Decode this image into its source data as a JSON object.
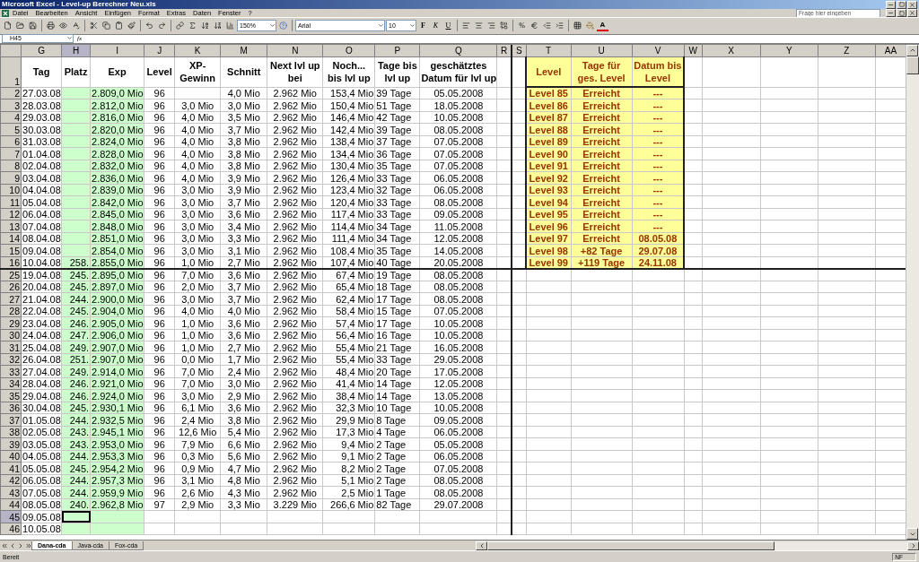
{
  "window": {
    "title": "Microsoft Excel - Level-up Berechner Neu.xls"
  },
  "menu": [
    {
      "label": "Datei"
    },
    {
      "label": "Bearbeiten"
    },
    {
      "label": "Ansicht"
    },
    {
      "label": "Einfügen"
    },
    {
      "label": "Format"
    },
    {
      "label": "Extras"
    },
    {
      "label": "Daten"
    },
    {
      "label": "Fenster"
    },
    {
      "label": "?"
    }
  ],
  "help_search": {
    "placeholder": "Frage hier eingeben"
  },
  "toolbar": {
    "zoom": "150%",
    "font": "Arial",
    "font_size": "10",
    "bold": "F",
    "italic": "K",
    "underline": "U",
    "percent": "%",
    "font_color": "A"
  },
  "formula_bar": {
    "name_box": "H45",
    "fx": "fx"
  },
  "columns": {
    "left": [
      {
        "label": "G",
        "selected": false,
        "shaded": false
      },
      {
        "label": "H",
        "selected": true,
        "shaded": true
      },
      {
        "label": "I",
        "selected": false,
        "shaded": true
      },
      {
        "label": "J",
        "selected": false,
        "shaded": false
      },
      {
        "label": "K",
        "selected": false,
        "shaded": false
      },
      {
        "label": "M",
        "selected": false,
        "shaded": false
      },
      {
        "label": "N",
        "selected": false,
        "shaded": false
      },
      {
        "label": "O",
        "selected": false,
        "shaded": false
      },
      {
        "label": "P",
        "selected": false,
        "shaded": false
      },
      {
        "label": "Q",
        "selected": false,
        "shaded": false
      },
      {
        "label": "R",
        "selected": false,
        "shaded": false
      }
    ],
    "right": [
      {
        "label": "S",
        "selected": false
      },
      {
        "label": "T",
        "selected": false
      },
      {
        "label": "U",
        "selected": false
      },
      {
        "label": "V",
        "selected": false
      },
      {
        "label": "W",
        "selected": false
      },
      {
        "label": "X",
        "selected": false
      },
      {
        "label": "Y",
        "selected": false
      },
      {
        "label": "Z",
        "selected": false
      },
      {
        "label": "AA",
        "selected": false
      }
    ]
  },
  "header_row": {
    "number": "1",
    "selected": false,
    "cells": [
      "Tag",
      "Platz",
      "Exp",
      "Level",
      "XP-\nGewinn",
      "Schnitt",
      "Next lvl up\nbei",
      "Noch...\nbis lvl up",
      "Tage bis\nlvl up",
      "geschätztes\nDatum für lvl up"
    ],
    "level_table": [
      "Level",
      "Tage für\nges. Level",
      "Datum bis\nLevel"
    ]
  },
  "top_rows": [
    {
      "number": "2",
      "selected": false,
      "cells": [
        "27.03.08",
        "",
        "2.809,0 Mio",
        "96",
        "",
        "4,0 Mio",
        "2.962 Mio",
        "153,4 Mio",
        "39 Tage",
        "05.05.2008"
      ],
      "level_table": [
        "Level 85",
        "Erreicht",
        "---"
      ]
    },
    {
      "number": "3",
      "selected": false,
      "cells": [
        "28.03.08",
        "",
        "2.812,0 Mio",
        "96",
        "3,0 Mio",
        "3,0 Mio",
        "2.962 Mio",
        "150,4 Mio",
        "51 Tage",
        "18.05.2008"
      ],
      "level_table": [
        "Level 86",
        "Erreicht",
        "---"
      ]
    },
    {
      "number": "4",
      "selected": false,
      "cells": [
        "29.03.08",
        "",
        "2.816,0 Mio",
        "96",
        "4,0 Mio",
        "3,5 Mio",
        "2.962 Mio",
        "146,4 Mio",
        "42 Tage",
        "10.05.2008"
      ],
      "level_table": [
        "Level 87",
        "Erreicht",
        "---"
      ]
    },
    {
      "number": "5",
      "selected": false,
      "cells": [
        "30.03.08",
        "",
        "2.820,0 Mio",
        "96",
        "4,0 Mio",
        "3,7 Mio",
        "2.962 Mio",
        "142,4 Mio",
        "39 Tage",
        "08.05.2008"
      ],
      "level_table": [
        "Level 88",
        "Erreicht",
        "---"
      ]
    },
    {
      "number": "6",
      "selected": false,
      "cells": [
        "31.03.08",
        "",
        "2.824,0 Mio",
        "96",
        "4,0 Mio",
        "3,8 Mio",
        "2.962 Mio",
        "138,4 Mio",
        "37 Tage",
        "07.05.2008"
      ],
      "level_table": [
        "Level 89",
        "Erreicht",
        "---"
      ]
    },
    {
      "number": "7",
      "selected": false,
      "cells": [
        "01.04.08",
        "",
        "2.828,0 Mio",
        "96",
        "4,0 Mio",
        "3,8 Mio",
        "2.962 Mio",
        "134,4 Mio",
        "36 Tage",
        "07.05.2008"
      ],
      "level_table": [
        "Level 90",
        "Erreicht",
        "---"
      ]
    },
    {
      "number": "8",
      "selected": false,
      "cells": [
        "02.04.08",
        "",
        "2.832,0 Mio",
        "96",
        "4,0 Mio",
        "3,8 Mio",
        "2.962 Mio",
        "130,4 Mio",
        "35 Tage",
        "07.05.2008"
      ],
      "level_table": [
        "Level 91",
        "Erreicht",
        "---"
      ]
    },
    {
      "number": "9",
      "selected": false,
      "cells": [
        "03.04.08",
        "",
        "2.836,0 Mio",
        "96",
        "4,0 Mio",
        "3,9 Mio",
        "2.962 Mio",
        "126,4 Mio",
        "33 Tage",
        "06.05.2008"
      ],
      "level_table": [
        "Level 92",
        "Erreicht",
        "---"
      ]
    },
    {
      "number": "10",
      "selected": false,
      "cells": [
        "04.04.08",
        "",
        "2.839,0 Mio",
        "96",
        "3,0 Mio",
        "3,9 Mio",
        "2.962 Mio",
        "123,4 Mio",
        "32 Tage",
        "06.05.2008"
      ],
      "level_table": [
        "Level 93",
        "Erreicht",
        "---"
      ]
    },
    {
      "number": "11",
      "selected": false,
      "cells": [
        "05.04.08",
        "",
        "2.842,0 Mio",
        "96",
        "3,0 Mio",
        "3,7 Mio",
        "2.962 Mio",
        "120,4 Mio",
        "33 Tage",
        "08.05.2008"
      ],
      "level_table": [
        "Level 94",
        "Erreicht",
        "---"
      ]
    },
    {
      "number": "12",
      "selected": false,
      "cells": [
        "06.04.08",
        "",
        "2.845,0 Mio",
        "96",
        "3,0 Mio",
        "3,6 Mio",
        "2.962 Mio",
        "117,4 Mio",
        "33 Tage",
        "09.05.2008"
      ],
      "level_table": [
        "Level 95",
        "Erreicht",
        "---"
      ]
    },
    {
      "number": "13",
      "selected": false,
      "cells": [
        "07.04.08",
        "",
        "2.848,0 Mio",
        "96",
        "3,0 Mio",
        "3,4 Mio",
        "2.962 Mio",
        "114,4 Mio",
        "34 Tage",
        "11.05.2008"
      ],
      "level_table": [
        "Level 96",
        "Erreicht",
        "---"
      ]
    },
    {
      "number": "14",
      "selected": false,
      "cells": [
        "08.04.08",
        "",
        "2.851,0 Mio",
        "96",
        "3,0 Mio",
        "3,3 Mio",
        "2.962 Mio",
        "111,4 Mio",
        "34 Tage",
        "12.05.2008"
      ],
      "level_table": [
        "Level 97",
        "Erreicht",
        "08.05.08"
      ]
    },
    {
      "number": "15",
      "selected": false,
      "cells": [
        "09.04.08",
        "",
        "2.854,0 Mio",
        "96",
        "3,0 Mio",
        "3,1 Mio",
        "2.962 Mio",
        "108,4 Mio",
        "35 Tage",
        "14.05.2008"
      ],
      "level_table": [
        "Level 98",
        "+82 Tage",
        "29.07.08"
      ]
    },
    {
      "number": "16",
      "selected": false,
      "cells": [
        "10.04.08",
        "258.",
        "2.855,0 Mio",
        "96",
        "1,0 Mio",
        "2,7 Mio",
        "2.962 Mio",
        "107,4 Mio",
        "40 Tage",
        "20.05.2008"
      ],
      "level_table": [
        "Level 99",
        "+119 Tage",
        "24.11.08"
      ]
    }
  ],
  "bottom_rows": [
    {
      "number": "25",
      "selected": false,
      "cells": [
        "19.04.08",
        "245.",
        "2.895,0 Mio",
        "96",
        "7,0 Mio",
        "3,6 Mio",
        "2.962 Mio",
        "67,4 Mio",
        "19 Tage",
        "08.05.2008"
      ]
    },
    {
      "number": "26",
      "selected": false,
      "cells": [
        "20.04.08",
        "245.",
        "2.897,0 Mio",
        "96",
        "2,0 Mio",
        "3,7 Mio",
        "2.962 Mio",
        "65,4 Mio",
        "18 Tage",
        "08.05.2008"
      ]
    },
    {
      "number": "27",
      "selected": false,
      "cells": [
        "21.04.08",
        "244.",
        "2.900,0 Mio",
        "96",
        "3,0 Mio",
        "3,7 Mio",
        "2.962 Mio",
        "62,4 Mio",
        "17 Tage",
        "08.05.2008"
      ]
    },
    {
      "number": "28",
      "selected": false,
      "cells": [
        "22.04.08",
        "245.",
        "2.904,0 Mio",
        "96",
        "4,0 Mio",
        "4,0 Mio",
        "2.962 Mio",
        "58,4 Mio",
        "15 Tage",
        "07.05.2008"
      ]
    },
    {
      "number": "29",
      "selected": false,
      "cells": [
        "23.04.08",
        "246.",
        "2.905,0 Mio",
        "96",
        "1,0 Mio",
        "3,6 Mio",
        "2.962 Mio",
        "57,4 Mio",
        "17 Tage",
        "10.05.2008"
      ]
    },
    {
      "number": "30",
      "selected": false,
      "cells": [
        "24.04.08",
        "247.",
        "2.906,0 Mio",
        "96",
        "1,0 Mio",
        "3,6 Mio",
        "2.962 Mio",
        "56,4 Mio",
        "16 Tage",
        "10.05.2008"
      ]
    },
    {
      "number": "31",
      "selected": false,
      "cells": [
        "25.04.08",
        "249.",
        "2.907,0 Mio",
        "96",
        "1,0 Mio",
        "2,7 Mio",
        "2.962 Mio",
        "55,4 Mio",
        "21 Tage",
        "16.05.2008"
      ]
    },
    {
      "number": "32",
      "selected": false,
      "cells": [
        "26.04.08",
        "251.",
        "2.907,0 Mio",
        "96",
        "0,0 Mio",
        "1,7 Mio",
        "2.962 Mio",
        "55,4 Mio",
        "33 Tage",
        "29.05.2008"
      ]
    },
    {
      "number": "33",
      "selected": false,
      "cells": [
        "27.04.08",
        "249.",
        "2.914,0 Mio",
        "96",
        "7,0 Mio",
        "2,4 Mio",
        "2.962 Mio",
        "48,4 Mio",
        "20 Tage",
        "17.05.2008"
      ]
    },
    {
      "number": "34",
      "selected": false,
      "cells": [
        "28.04.08",
        "246.",
        "2.921,0 Mio",
        "96",
        "7,0 Mio",
        "3,0 Mio",
        "2.962 Mio",
        "41,4 Mio",
        "14 Tage",
        "12.05.2008"
      ]
    },
    {
      "number": "35",
      "selected": false,
      "cells": [
        "29.04.08",
        "246.",
        "2.924,0 Mio",
        "96",
        "3,0 Mio",
        "2,9 Mio",
        "2.962 Mio",
        "38,4 Mio",
        "14 Tage",
        "13.05.2008"
      ]
    },
    {
      "number": "36",
      "selected": false,
      "cells": [
        "30.04.08",
        "245.",
        "2.930,1 Mio",
        "96",
        "6,1 Mio",
        "3,6 Mio",
        "2.962 Mio",
        "32,3 Mio",
        "10 Tage",
        "10.05.2008"
      ]
    },
    {
      "number": "37",
      "selected": false,
      "cells": [
        "01.05.08",
        "244.",
        "2.932,5 Mio",
        "96",
        "2,4 Mio",
        "3,8 Mio",
        "2.962 Mio",
        "29,9 Mio",
        "8 Tage",
        "09.05.2008"
      ]
    },
    {
      "number": "38",
      "selected": false,
      "cells": [
        "02.05.08",
        "243.",
        "2.945,1 Mio",
        "96",
        "12,6 Mio",
        "5,4 Mio",
        "2.962 Mio",
        "17,3 Mio",
        "4 Tage",
        "06.05.2008"
      ]
    },
    {
      "number": "39",
      "selected": false,
      "cells": [
        "03.05.08",
        "243.",
        "2.953,0 Mio",
        "96",
        "7,9 Mio",
        "6,6 Mio",
        "2.962 Mio",
        "9,4 Mio",
        "2 Tage",
        "05.05.2008"
      ]
    },
    {
      "number": "40",
      "selected": false,
      "cells": [
        "04.05.08",
        "244.",
        "2.953,3 Mio",
        "96",
        "0,3 Mio",
        "5,6 Mio",
        "2.962 Mio",
        "9,1 Mio",
        "2 Tage",
        "06.05.2008"
      ]
    },
    {
      "number": "41",
      "selected": false,
      "cells": [
        "05.05.08",
        "245.",
        "2.954,2 Mio",
        "96",
        "0,9 Mio",
        "4,7 Mio",
        "2.962 Mio",
        "8,2 Mio",
        "2 Tage",
        "07.05.2008"
      ]
    },
    {
      "number": "42",
      "selected": false,
      "cells": [
        "06.05.08",
        "244.",
        "2.957,3 Mio",
        "96",
        "3,1 Mio",
        "4,8 Mio",
        "2.962 Mio",
        "5,1 Mio",
        "2 Tage",
        "08.05.2008"
      ]
    },
    {
      "number": "43",
      "selected": false,
      "cells": [
        "07.05.08",
        "244.",
        "2.959,9 Mio",
        "96",
        "2,6 Mio",
        "4,3 Mio",
        "2.962 Mio",
        "2,5 Mio",
        "1 Tage",
        "08.05.2008"
      ]
    },
    {
      "number": "44",
      "selected": false,
      "cells": [
        "08.05.08",
        "240.",
        "2.962,8 Mio",
        "97",
        "2,9 Mio",
        "3,3 Mio",
        "3.229 Mio",
        "266,6 Mio",
        "82 Tage",
        "29.07.2008"
      ]
    },
    {
      "number": "45",
      "selected": true,
      "cells": [
        "09.05.08"
      ]
    },
    {
      "number": "46",
      "selected": false,
      "cells": [
        "10.05.08"
      ]
    }
  ],
  "sheet_tabs": [
    {
      "label": "Dana-cda",
      "selected": true
    },
    {
      "label": "Java-cda",
      "selected": false
    },
    {
      "label": "Fox-cda",
      "selected": false
    }
  ],
  "status_bar": {
    "status": "Bereit",
    "indicator": "NF"
  }
}
